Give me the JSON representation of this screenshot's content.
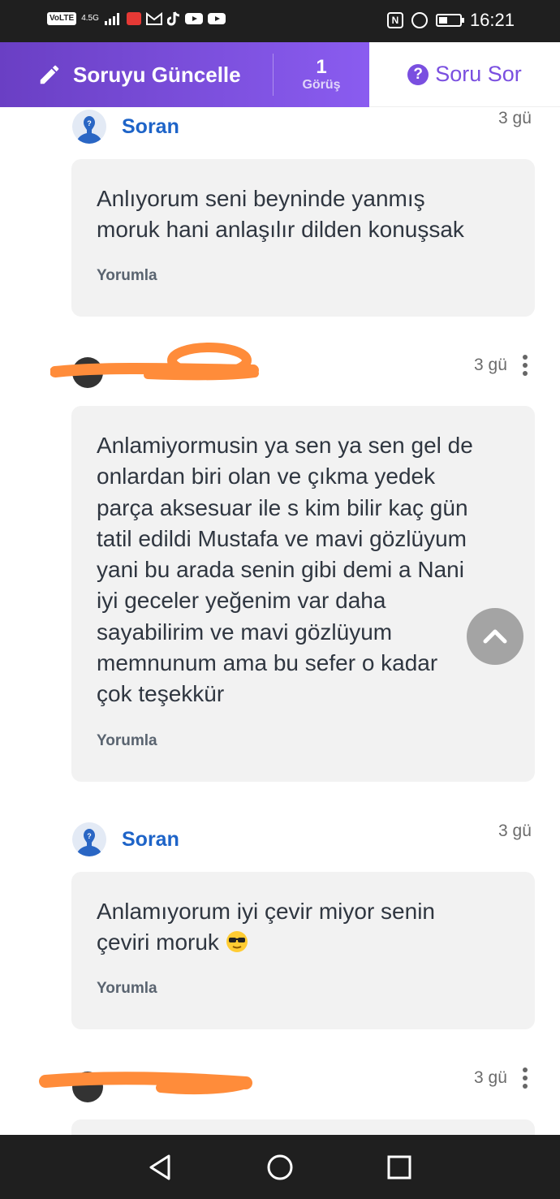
{
  "status_bar": {
    "network_chip": "VoLTE",
    "signal_text": "4.5G",
    "nfc_label": "N",
    "time": "16:21"
  },
  "top_bar": {
    "edit_label": "Soruyu Güncelle",
    "views_count": "1",
    "views_label": "Görüş",
    "ask_label": "Soru Sor",
    "ask_icon_glyph": "?",
    "accent_color": "#7a4fe0"
  },
  "thread": [
    {
      "author": "Soran",
      "time": "3 gü",
      "text": "Anlıyorum seni beyninde yanmış\nmoruk hani anlaşılır dilden konuşsak",
      "action": "Yorumla"
    },
    {
      "author": "",
      "time": "3 gü",
      "text": "Anlamiyormusin ya sen ya sen gel de\nonlardan biri olan ve çıkma yedek\nparça aksesuar ile s kim bilir kaç gün\ntatil edildi Mustafa ve mavi gözlüyum\nyani bu arada senin gibi demi a Nani\niyi geceler yeğenim var daha\nsayabilirim ve mavi gözlüyum\nmemnunum ama bu sefer o kadar\nçok teşekkür",
      "action": "Yorumla"
    },
    {
      "author": "Soran",
      "time": "3 gü",
      "text": "Anlamıyorum iyi çevir miyor senin\nçeviri moruk",
      "action": "Yorumla"
    },
    {
      "author": "",
      "time": "3 gü"
    }
  ],
  "icons": {
    "edit": "pencil-icon",
    "ask": "question-circle-icon",
    "scroll_top": "chevron-up-icon",
    "kebab": "more-vertical-icon",
    "emoji": "sunglasses-emoji-icon",
    "nav_back": "back-triangle-icon",
    "nav_home": "home-circle-icon",
    "nav_recent": "recent-square-icon"
  }
}
